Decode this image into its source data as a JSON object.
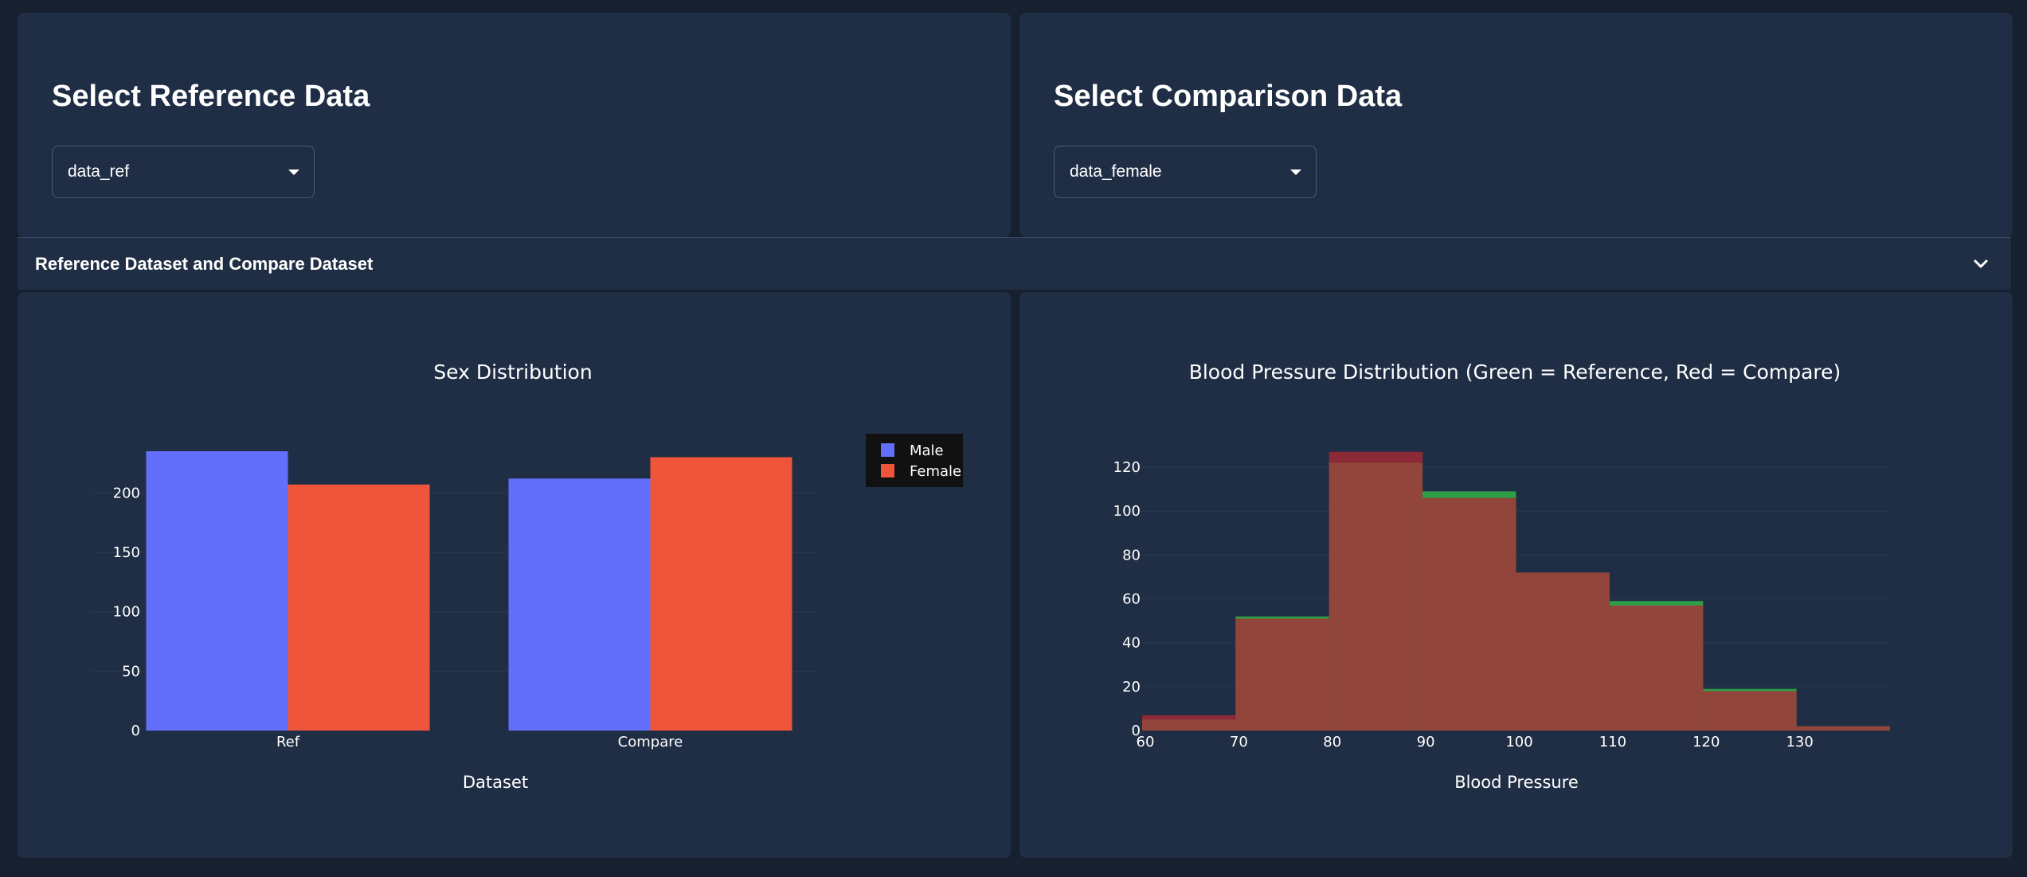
{
  "reference_panel": {
    "title": "Select Reference Data",
    "dropdown_value": "data_ref"
  },
  "comparison_panel": {
    "title": "Select Comparison Data",
    "dropdown_value": "data_female"
  },
  "accordion": {
    "label": "Reference Dataset and Compare Dataset"
  },
  "colors": {
    "male": "#636efa",
    "female": "#ef553b",
    "reference": "#2e9e48",
    "compare": "#8b2a36",
    "overlap": "#92453a"
  },
  "chart_data": [
    {
      "type": "bar",
      "title": "Sex Distribution",
      "xlabel": "Dataset",
      "ylabel": "",
      "categories": [
        "Ref",
        "Compare"
      ],
      "series": [
        {
          "name": "Male",
          "values": [
            235,
            212
          ]
        },
        {
          "name": "Female",
          "values": [
            207,
            230
          ]
        }
      ],
      "ylim": [
        0,
        235
      ],
      "yticks": [
        0,
        50,
        100,
        150,
        200
      ],
      "legend": {
        "placement": "top-right"
      },
      "grid": true
    },
    {
      "type": "bar",
      "title": "Blood Pressure Distribution (Green = Reference, Red = Compare)",
      "xlabel": "Blood Pressure",
      "ylabel": "",
      "bins": [
        60,
        70,
        80,
        90,
        100,
        110,
        120,
        130,
        140
      ],
      "series": [
        {
          "name": "Reference",
          "values": [
            5,
            52,
            122,
            109,
            72,
            59,
            19,
            2
          ]
        },
        {
          "name": "Compare",
          "values": [
            7,
            51,
            127,
            106,
            72,
            57,
            18,
            2
          ]
        }
      ],
      "xticks": [
        60,
        70,
        80,
        90,
        100,
        110,
        120,
        130
      ],
      "yticks": [
        0,
        20,
        40,
        60,
        80,
        100,
        120
      ],
      "xlim": [
        60,
        140
      ],
      "ylim": [
        0,
        128
      ],
      "grid": true
    }
  ]
}
